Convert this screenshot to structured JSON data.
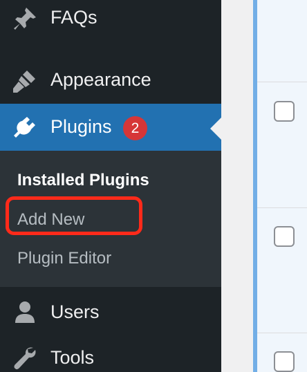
{
  "sidebar": {
    "items": [
      {
        "label": "FAQs",
        "icon": "pin-icon"
      },
      {
        "label": "Appearance",
        "icon": "paintbrush-icon"
      },
      {
        "label": "Plugins",
        "icon": "plug-icon",
        "badge": "2",
        "active": true
      },
      {
        "label": "Users",
        "icon": "user-icon"
      },
      {
        "label": "Tools",
        "icon": "wrench-icon"
      }
    ],
    "submenu": [
      {
        "label": "Installed Plugins",
        "current": true
      },
      {
        "label": "Add New",
        "highlighted": true
      },
      {
        "label": "Plugin Editor"
      }
    ]
  },
  "colors": {
    "sidebar_bg": "#1d2327",
    "active_bg": "#2271b1",
    "submenu_bg": "#2c3338",
    "badge_bg": "#d63638",
    "highlight_outline": "#ff2a1a"
  }
}
